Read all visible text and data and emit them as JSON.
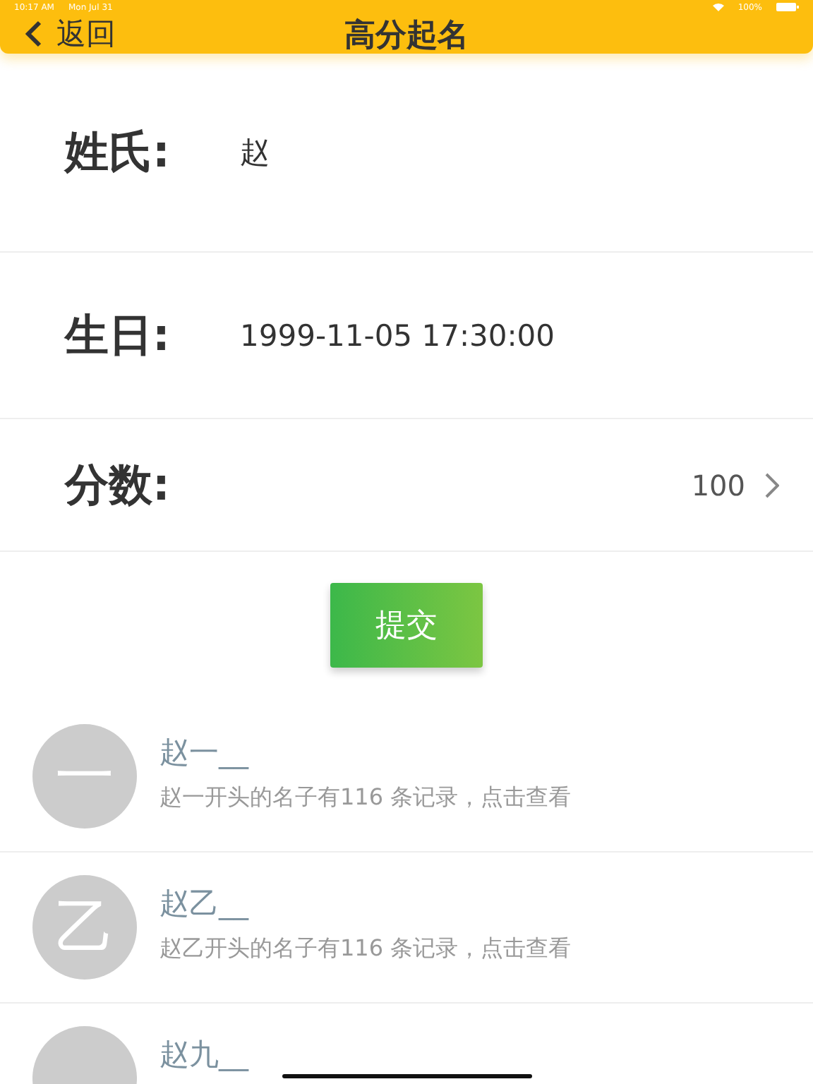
{
  "status_bar": {
    "time": "10:17 AM",
    "date": "Mon Jul 31",
    "battery": "100%"
  },
  "nav": {
    "back": "返回",
    "title": "高分起名"
  },
  "fields": [
    {
      "kind": "text",
      "label": "姓氏:",
      "value": "赵"
    },
    {
      "kind": "text",
      "label": "生日:",
      "value": "1999-11-05 17:30:00"
    },
    {
      "kind": "picker",
      "label": "分数:",
      "value": "100"
    }
  ],
  "submit": "提交",
  "results": [
    {
      "avatar": "一",
      "name": "赵一__",
      "detail": "赵一开头的名子有116 条记录，点击查看"
    },
    {
      "avatar": "乙",
      "name": "赵乙__",
      "detail": "赵乙开头的名子有116 条记录，点击查看"
    },
    {
      "name": "赵九__"
    }
  ]
}
